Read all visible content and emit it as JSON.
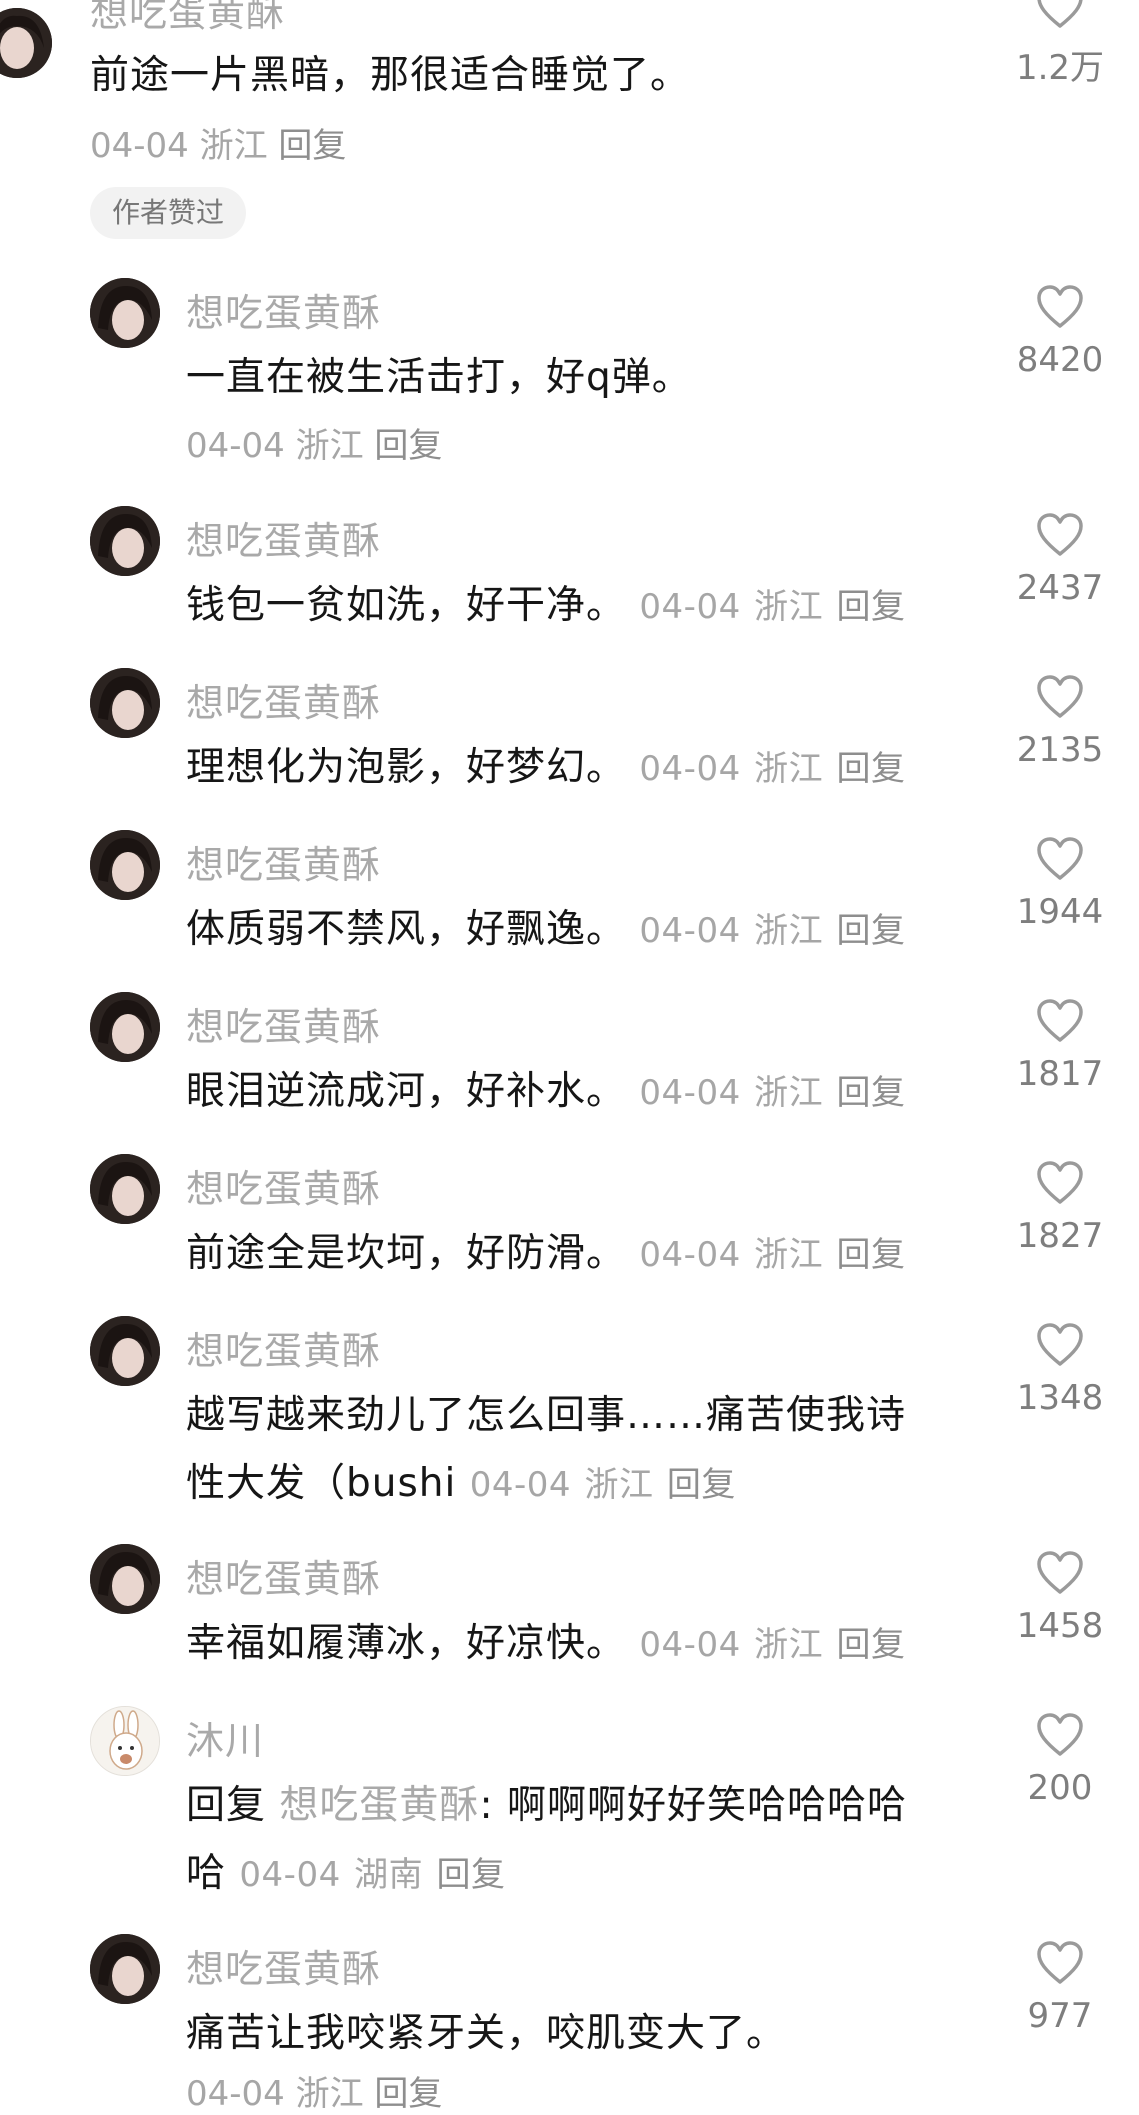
{
  "badge": "作者赞过",
  "comments": [
    {
      "name": "想吃蛋黄酥",
      "text": "前途一片黑暗，那很适合睡觉了。",
      "date": "04-04",
      "region": "浙江",
      "reply": "回复",
      "likes": "1.2万"
    },
    {
      "name": "想吃蛋黄酥",
      "text": "一直在被生活击打，好q弹。",
      "date": "04-04",
      "region": "浙江",
      "reply": "回复",
      "likes": "8420"
    },
    {
      "name": "想吃蛋黄酥",
      "text": "钱包一贫如洗，好干净。",
      "date": "04-04",
      "region": "浙江",
      "reply": "回复",
      "likes": "2437"
    },
    {
      "name": "想吃蛋黄酥",
      "text": "理想化为泡影，好梦幻。",
      "date": "04-04",
      "region": "浙江",
      "reply": "回复",
      "likes": "2135"
    },
    {
      "name": "想吃蛋黄酥",
      "text": "体质弱不禁风，好飘逸。",
      "date": "04-04",
      "region": "浙江",
      "reply": "回复",
      "likes": "1944"
    },
    {
      "name": "想吃蛋黄酥",
      "text": "眼泪逆流成河，好补水。",
      "date": "04-04",
      "region": "浙江",
      "reply": "回复",
      "likes": "1817"
    },
    {
      "name": "想吃蛋黄酥",
      "text": "前途全是坎坷，好防滑。",
      "date": "04-04",
      "region": "浙江",
      "reply": "回复",
      "likes": "1827"
    },
    {
      "name": "想吃蛋黄酥",
      "text": "越写越来劲儿了怎么回事……痛苦使我诗",
      "text2": "性大发（bushi",
      "date": "04-04",
      "region": "浙江",
      "reply": "回复",
      "likes": "1348"
    },
    {
      "name": "想吃蛋黄酥",
      "text": "幸福如履薄冰，好凉快。",
      "date": "04-04",
      "region": "浙江",
      "reply": "回复",
      "likes": "1458"
    },
    {
      "name": "沐川",
      "reply_prefix": "回复",
      "reply_to": "想吃蛋黄酥",
      "text": ": 啊啊啊好好笑哈哈哈哈",
      "text2": "哈",
      "date": "04-04",
      "region": "湖南",
      "reply": "回复",
      "likes": "200"
    },
    {
      "name": "想吃蛋黄酥",
      "text": "痛苦让我咬紧牙关，咬肌变大了。",
      "date": "04-04",
      "region": "浙江",
      "reply": "回复",
      "likes": "977"
    }
  ],
  "colors": {
    "name": "#a9a9a9",
    "text": "#161616",
    "meta": "#a6a6a6",
    "count": "#7e7e7e",
    "badge_bg": "#f2f2f2"
  },
  "icons": {
    "like": "heart-outline-icon",
    "avatar_user": "woman-portrait-avatar",
    "avatar_reply": "rabbit-avatar"
  }
}
